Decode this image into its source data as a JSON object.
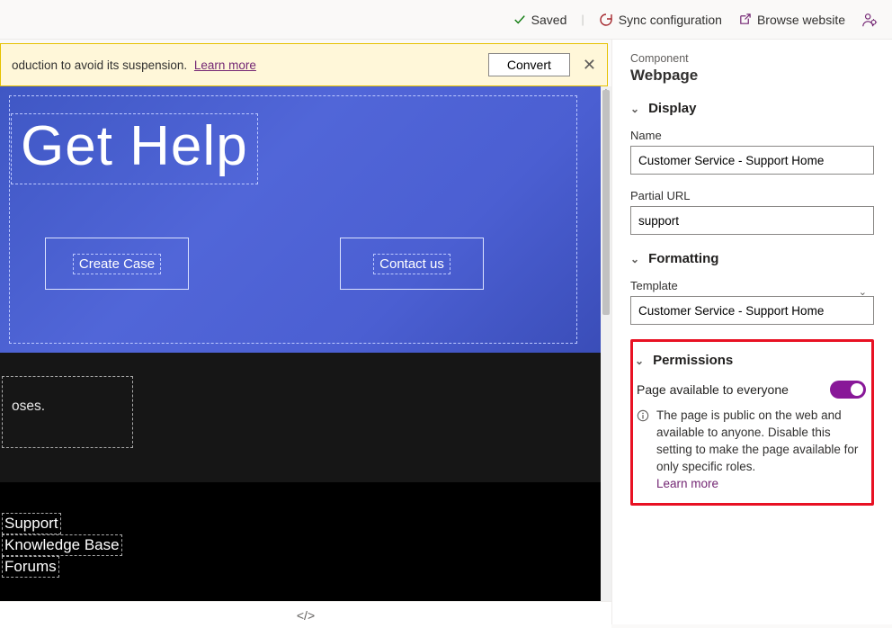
{
  "topbar": {
    "saved_label": "Saved",
    "sync_label": "Sync configuration",
    "browse_label": "Browse website"
  },
  "notice": {
    "text_fragment": "oduction to avoid its suspension.",
    "learn_more": "Learn more",
    "convert_label": "Convert"
  },
  "hero": {
    "title": "Get Help",
    "button1": "Create Case",
    "button2": "Contact us"
  },
  "dark1": {
    "line1": "oses."
  },
  "footer_links": {
    "l1": "Support",
    "l2": "Knowledge Base",
    "l3": "Forums"
  },
  "sidebar": {
    "component_label": "Component",
    "component_value": "Webpage",
    "sections": {
      "display": "Display",
      "formatting": "Formatting",
      "permissions": "Permissions"
    },
    "name": {
      "label": "Name",
      "value": "Customer Service - Support Home"
    },
    "partial_url": {
      "label": "Partial URL",
      "value": "support"
    },
    "template": {
      "label": "Template",
      "value": "Customer Service - Support Home"
    },
    "permissions": {
      "toggle_label": "Page available to everyone",
      "info_text": "The page is public on the web and available to anyone. Disable this setting to make the page available for only specific roles.",
      "learn_more": "Learn more"
    }
  },
  "bottom_tool": {
    "code_icon": "</>"
  }
}
